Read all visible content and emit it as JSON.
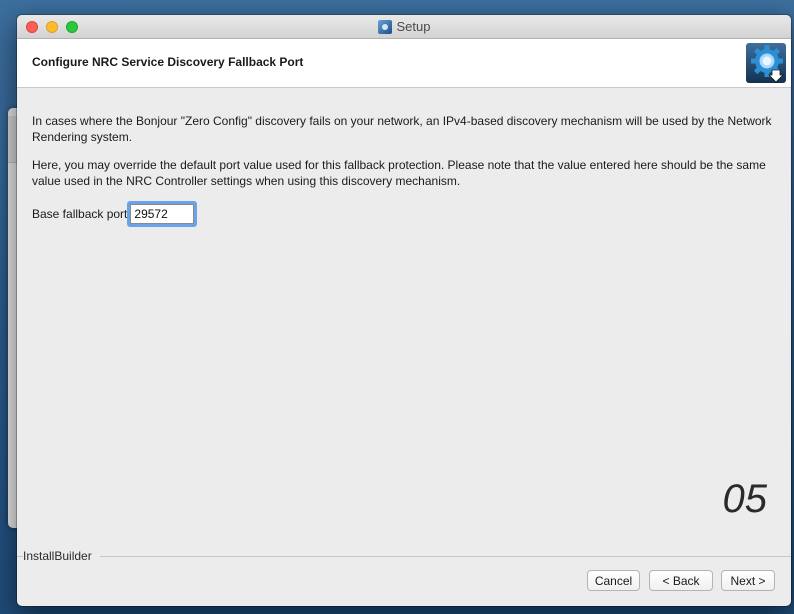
{
  "window": {
    "title": "Setup",
    "app_icon": "setup-app-icon"
  },
  "header": {
    "title": "Configure NRC Service Discovery Fallback Port",
    "logo_icon": "installer-gear-download-icon"
  },
  "content": {
    "paragraph_1": "In cases where the Bonjour \"Zero Config\" discovery fails on your network, an IPv4-based discovery mechanism will be used by the Network Rendering system.",
    "paragraph_2": "Here, you may override the default port value used for this fallback protection.  Please note that the value entered here should be the same value used in the NRC Controller settings when using this discovery mechanism.",
    "port_label": "Base fallback port",
    "port_value": "29572",
    "step_number": "05"
  },
  "footer": {
    "brand": "InstallBuilder",
    "cancel_label": "Cancel",
    "back_label": "< Back",
    "next_label": "Next >"
  },
  "colors": {
    "focus_ring": "#6aa4e8",
    "close": "#fc5f57",
    "minimize": "#fdbc2e",
    "maximize": "#29c840"
  }
}
